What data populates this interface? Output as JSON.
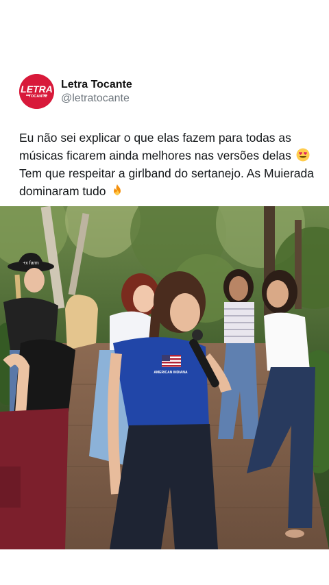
{
  "post": {
    "author": {
      "display_name": "Letra Tocante",
      "handle": "@letratocante",
      "avatar_logo_text": "LETRA TOCANTE"
    },
    "caption_parts": {
      "p1": "Eu não sei explicar o que elas fazem para todas as músicas ficarem ainda melhores nas versões delas",
      "p2": " Tem que respeitar a girlband do sertanejo. As Muierada dominaram tudo",
      "emoji_1": "smiling-face-with-heart-eyes",
      "emoji_2": "fire"
    },
    "photo": {
      "shirt_text": "AMERICAN INDIANA",
      "hat_text": "+x farm"
    }
  },
  "colors": {
    "brand_red": "#d8193a",
    "text": "#14171a",
    "secondary_text": "#6e767d"
  }
}
